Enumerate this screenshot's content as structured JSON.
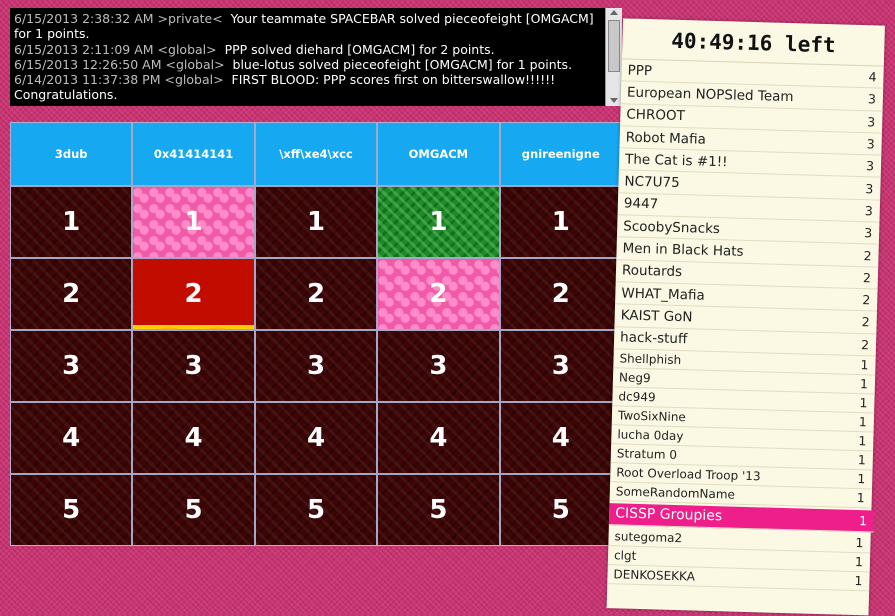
{
  "chat": {
    "lines": [
      {
        "ts": "6/15/2013 2:38:32 AM >private<",
        "msg": "Your teammate SPACEBAR solved pieceofeight [OMGACM] for 1 points."
      },
      {
        "ts": "6/15/2013 2:11:09 AM <global>",
        "msg": "PPP solved diehard [OMGACM] for 2 points."
      },
      {
        "ts": "6/15/2013 12:26:50 AM <global>",
        "msg": "blue-lotus solved pieceofeight [OMGACM] for 1 points."
      },
      {
        "ts": "6/14/2013 11:37:38 PM <global>",
        "msg": "FIRST BLOOD: PPP scores first on bitterswallow!!!!!! Congratulations."
      }
    ]
  },
  "board": {
    "categories": [
      "3dub",
      "0x41414141",
      "\\xff\\xe4\\xcc",
      "OMGACM",
      "gnireenigne"
    ],
    "rows": [
      [
        "1",
        "1",
        "1",
        "1",
        "1"
      ],
      [
        "2",
        "2",
        "2",
        "2",
        "2"
      ],
      [
        "3",
        "3",
        "3",
        "3",
        "3"
      ],
      [
        "4",
        "4",
        "4",
        "4",
        "4"
      ],
      [
        "5",
        "5",
        "5",
        "5",
        "5"
      ]
    ]
  },
  "scoreboard": {
    "timer": "40:49:16 left",
    "teams": [
      {
        "name": "PPP",
        "score": "4"
      },
      {
        "name": "European NOPSled Team",
        "score": "3"
      },
      {
        "name": "CHROOT",
        "score": "3"
      },
      {
        "name": "Robot Mafia",
        "score": "3"
      },
      {
        "name": "The Cat is #1!!",
        "score": "3"
      },
      {
        "name": "NC7U75",
        "score": "3"
      },
      {
        "name": "9447",
        "score": "3"
      },
      {
        "name": "ScoobySnacks",
        "score": "3"
      },
      {
        "name": "Men in Black Hats",
        "score": "2"
      },
      {
        "name": "Routards",
        "score": "2"
      },
      {
        "name": "WHAT_Mafia",
        "score": "2"
      },
      {
        "name": "KAIST GoN",
        "score": "2"
      },
      {
        "name": "hack-stuff",
        "score": "2"
      },
      {
        "name": "Shellphish",
        "score": "1"
      },
      {
        "name": "Neg9",
        "score": "1"
      },
      {
        "name": "dc949",
        "score": "1"
      },
      {
        "name": "TwoSixNine",
        "score": "1"
      },
      {
        "name": "lucha 0day",
        "score": "1"
      },
      {
        "name": "Stratum 0",
        "score": "1"
      },
      {
        "name": "Root Overload Troop '13",
        "score": "1"
      },
      {
        "name": "SomeRandomName",
        "score": "1"
      },
      {
        "name": "CISSP Groupies",
        "score": "1"
      },
      {
        "name": "sutegoma2",
        "score": "1"
      },
      {
        "name": "clgt",
        "score": "1"
      },
      {
        "name": "DENKOSEKKA",
        "score": "1"
      }
    ]
  }
}
